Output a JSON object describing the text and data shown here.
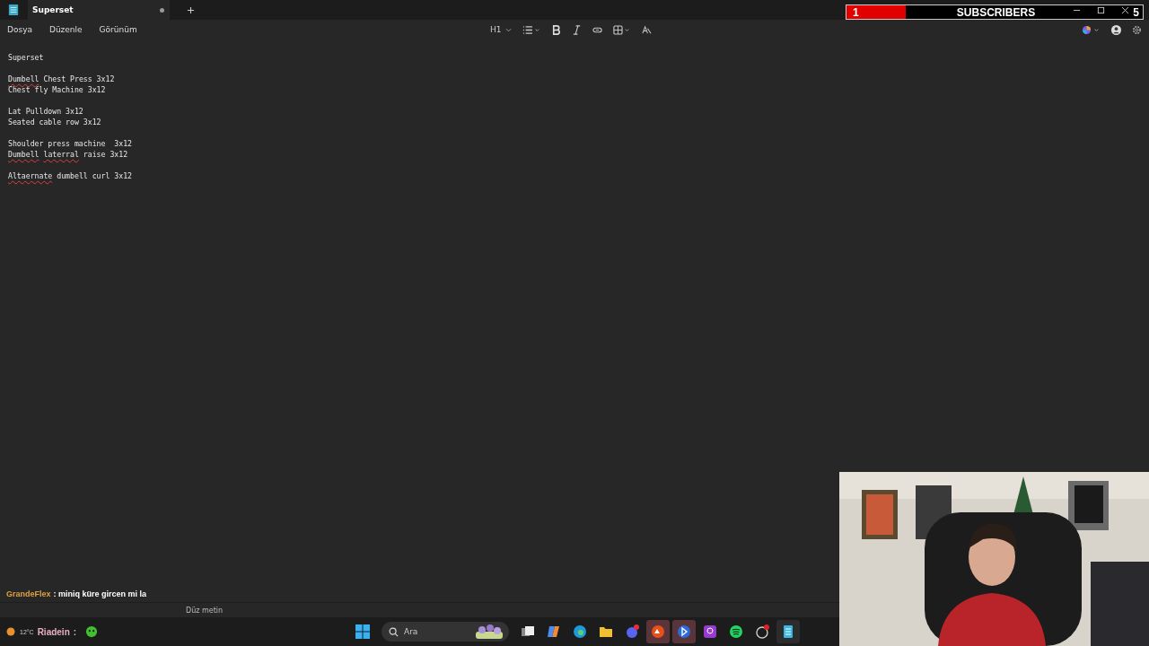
{
  "tab": {
    "title": "Superset",
    "unsaved": true
  },
  "menu": [
    "Dosya",
    "Düzenle",
    "Görünüm"
  ],
  "toolbar": {
    "heading": "H1"
  },
  "document": {
    "paragraphs": [
      [
        [
          {
            "text": "Superset",
            "misspelled": false
          }
        ]
      ],
      [
        [
          {
            "text": "Dumbell",
            "misspelled": true
          },
          {
            "text": "Chest Press 3x12",
            "misspelled": false
          }
        ],
        [
          {
            "text": "Chest fly Machine 3x12",
            "misspelled": false
          }
        ]
      ],
      [
        [
          {
            "text": "Lat Pulldown 3x12",
            "misspelled": false
          }
        ],
        [
          {
            "text": "Seated cable row 3x12",
            "misspelled": false
          }
        ]
      ],
      [
        [
          {
            "text": "Shoulder press machine  3x12",
            "misspelled": false
          }
        ],
        [
          {
            "text": "Dumbell",
            "misspelled": true
          },
          {
            "text": "laterral",
            "misspelled": true
          },
          {
            "text": "raise 3x12",
            "misspelled": false
          }
        ]
      ],
      [
        [
          {
            "text": "Altaernate",
            "misspelled": true
          },
          {
            "text": "dumbell curl 3x12",
            "misspelled": false
          }
        ]
      ]
    ]
  },
  "status_bar": {
    "format": "Düz metin"
  },
  "subscriber_widget": {
    "count": "1",
    "label": "SUBSCRIBERS",
    "goal": "5",
    "level": 0.2
  },
  "chat": [
    {
      "user": "GrandeFlex",
      "separator": ":",
      "message": "miniq küre gircen mi la",
      "color": "#e0a040"
    },
    {
      "user": "Riadein",
      "separator": ":",
      "color": "#e8b0c0"
    }
  ],
  "weather": {
    "temperature": "12°C"
  },
  "taskbar": {
    "search_placeholder": "Ara"
  }
}
